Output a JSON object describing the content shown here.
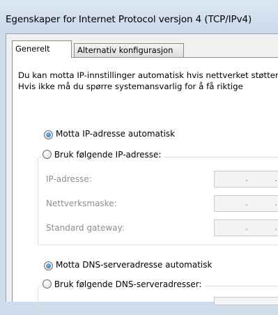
{
  "window": {
    "title": "Egenskaper for Internet Protocol versjon 4 (TCP/IPv4)"
  },
  "tabs": [
    {
      "label": "Generelt",
      "active": true
    },
    {
      "label": "Alternativ konfigurasjon",
      "active": false
    }
  ],
  "description": {
    "line1": "Du kan motta IP-innstillinger automatisk hvis nettverket støtter",
    "line2": "Hvis ikke må du spørre systemansvarlig for å få riktige"
  },
  "ip_section": {
    "auto_option": "Motta IP-adresse automatisk",
    "manual_option": "Bruk følgende IP-adresse:",
    "auto_selected": true,
    "fields": [
      {
        "label": "IP-adresse:"
      },
      {
        "label": "Nettverksmaske:"
      },
      {
        "label": "Standard gateway:"
      }
    ]
  },
  "dns_section": {
    "auto_option": "Motta DNS-serveradresse automatisk",
    "manual_option": "Bruk følgende DNS-serveradresser:",
    "auto_selected": true
  },
  "colors": {
    "title_bar": "#cfdceb",
    "radio_fill": "#1e63b8",
    "disabled_text": "#8d8d8d"
  }
}
